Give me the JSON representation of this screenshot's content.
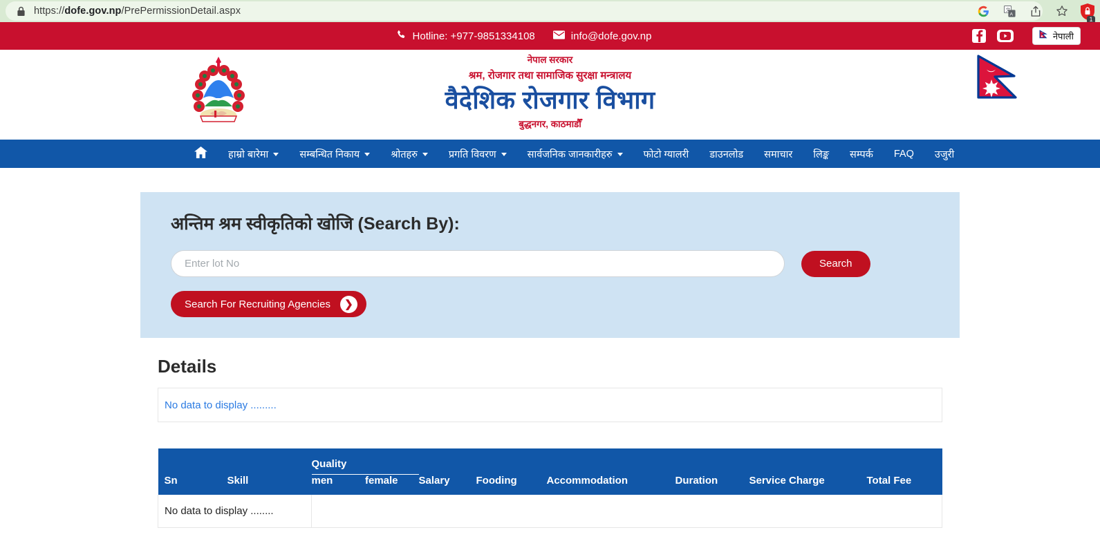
{
  "browser": {
    "url_prefix": "https://",
    "url_domain": "dofe.gov.np",
    "url_path": "/PrePermissionDetail.aspx",
    "url_full": "https://dofe.gov.np/PrePermissionDetail.aspx",
    "lock_icon": "lock-icon",
    "icons": [
      "google-icon",
      "translate-icon",
      "share-icon",
      "bookmark-star-icon",
      "extension-shield-icon"
    ],
    "extension_badge_count": "1"
  },
  "topbar": {
    "hotline_label": "Hotline: +977-9851334108",
    "email": "info@dofe.gov.np",
    "phone_icon": "phone-icon",
    "mail_icon": "envelope-icon",
    "facebook_icon": "facebook-icon",
    "youtube_icon": "youtube-icon",
    "language_button": "नेपाली",
    "flag_icon": "nepal-flag-icon",
    "bg_color": "#c8102e"
  },
  "masthead": {
    "emblem_icon": "nepal-emblem-icon",
    "flag_icon": "nepal-flag-icon",
    "government": "नेपाल सरकार",
    "ministry": "श्रम, रोजगार तथा सामाजिक सुरक्षा मन्त्रालय",
    "department": "वैदेशिक रोजगार विभाग",
    "address": "बुद्धनगर, काठमाडौँ",
    "title_color": "#1a4fa0",
    "accent_color": "#c8102e"
  },
  "nav": {
    "bg_color": "#1157a8",
    "home_icon": "home-icon",
    "items": [
      {
        "label": "",
        "icon": "home-icon",
        "caret": false
      },
      {
        "label": "हाम्रो बारेमा",
        "caret": true
      },
      {
        "label": "सम्बन्धित निकाय",
        "caret": true
      },
      {
        "label": "श्रोतहरु",
        "caret": true
      },
      {
        "label": "प्रगति विवरण",
        "caret": true
      },
      {
        "label": "सार्वजनिक जानकारीहरु",
        "caret": true
      },
      {
        "label": "फोटो ग्यालरी",
        "caret": false
      },
      {
        "label": "डाउनलोड",
        "caret": false
      },
      {
        "label": "समाचार",
        "caret": false
      },
      {
        "label": "लिङ्क",
        "caret": false
      },
      {
        "label": "सम्पर्क",
        "caret": false
      },
      {
        "label": "FAQ",
        "caret": false
      },
      {
        "label": "उजुरी",
        "caret": false
      }
    ]
  },
  "search": {
    "title": "अन्तिम श्रम स्वीकृतिको खोजि (Search By):",
    "input_value": "",
    "input_placeholder": "Enter lot No",
    "search_button": "Search",
    "agency_button": "Search For Recruiting Agencies",
    "arrow_icon": "chevron-right-icon",
    "panel_bg": "#cfe3f3",
    "button_color": "#c01020"
  },
  "details": {
    "heading": "Details",
    "no_data_message": "No data to display ........."
  },
  "table": {
    "group_header": "Quality",
    "columns": [
      "Sn",
      "Skill",
      "men",
      "female",
      "Salary",
      "Fooding",
      "Accommodation",
      "Duration",
      "Service Charge",
      "Total Fee"
    ],
    "rows": [],
    "empty_message": "No data to display ........",
    "header_bg": "#1157a8"
  }
}
